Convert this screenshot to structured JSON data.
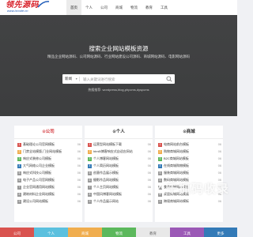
{
  "logo": {
    "name": "领先源码",
    "url": "www.lxcode.cn"
  },
  "nav": [
    {
      "label": "首页",
      "active": true
    },
    {
      "label": "个人",
      "active": false
    },
    {
      "label": "公司",
      "active": false
    },
    {
      "label": "商城",
      "active": false
    },
    {
      "label": "物流",
      "active": false
    },
    {
      "label": "教育",
      "active": false
    },
    {
      "label": "工具",
      "active": false
    }
  ],
  "hero": {
    "title": "搜索企业网站模板资源",
    "subtitle": "精品企业网站源码、公司网站源码、行业网站建设公司源码、商城网站源码、电影网站源码",
    "search_category": "新闻",
    "search_placeholder": "输入关键词进行搜索",
    "hot": "热搜推荐: wordpress,blog,phpcms,dyspcms"
  },
  "panels": [
    {
      "title": "⊙公司",
      "rows": [
        {
          "n": "1",
          "text": "基础理论公司官网模板",
          "date": "06"
        },
        {
          "n": "2",
          "text": "门禁全站模版,门业网站模板",
          "date": "06"
        },
        {
          "n": "3",
          "text": "响应式装修公司模板",
          "date": "06"
        },
        {
          "n": "4",
          "text": "大气网络公司企业模板",
          "date": "06"
        },
        {
          "n": "5",
          "text": "响应式科技公司模板",
          "date": "06"
        },
        {
          "n": "6",
          "text": "电子产品公司官网模板",
          "date": "06"
        },
        {
          "n": "7",
          "text": "企业官网通用网站模板",
          "date": "06"
        },
        {
          "n": "8",
          "text": "建筑材料企业网站模板",
          "date": "06"
        },
        {
          "n": "9",
          "text": "建设公司网站模板",
          "date": "06"
        }
      ]
    },
    {
      "title": "⊙个人",
      "rows": [
        {
          "n": "1",
          "text": "运营型网站模板下载",
          "date": "06"
        },
        {
          "n": "2",
          "text": "html5博客响应式自适应网站",
          "date": "06"
        },
        {
          "n": "3",
          "text": "个人博客网站模板",
          "date": "06"
        },
        {
          "n": "4",
          "text": "个人简历网站模板",
          "date": "06"
        },
        {
          "n": "5",
          "text": "创意作品展示模板",
          "date": "06"
        },
        {
          "n": "6",
          "text": "摄影作品网站模板",
          "date": "06"
        },
        {
          "n": "7",
          "text": "个人主页网站模板",
          "date": "06"
        },
        {
          "n": "8",
          "text": "中国风博客网站模板",
          "date": "06"
        },
        {
          "n": "9",
          "text": "个人作品展示网站",
          "date": "06"
        }
      ]
    },
    {
      "title": "⊙商城",
      "rows": [
        {
          "n": "1",
          "text": "电商网站前台模板",
          "date": "06"
        },
        {
          "n": "2",
          "text": "购物商城网站模板",
          "date": "06"
        },
        {
          "n": "3",
          "text": "B2C商城网站模板",
          "date": "06"
        },
        {
          "n": "4",
          "text": "在线商城购物模板",
          "date": "06"
        },
        {
          "n": "5",
          "text": "服装商城网站模板",
          "date": "06"
        },
        {
          "n": "6",
          "text": "数码商城网站模板",
          "date": "06"
        },
        {
          "n": "7",
          "text": "食品商城网站模板",
          "date": "06"
        },
        {
          "n": "8",
          "text": "家居商城网站模板",
          "date": "06"
        },
        {
          "n": "9",
          "text": "跨境商城网站模板",
          "date": "06"
        }
      ]
    }
  ],
  "categories": [
    {
      "label": "公司",
      "color": "#d9534f"
    },
    {
      "label": "个人",
      "color": "#5bc0de"
    },
    {
      "label": "商城",
      "color": "#f0ad4e"
    },
    {
      "label": "物流",
      "color": "#5cb85c"
    },
    {
      "label": "教育",
      "color": "#e8e8e8"
    },
    {
      "label": "工具",
      "color": "#9b59b6"
    },
    {
      "label": "更多",
      "color": "#337ab7"
    }
  ],
  "watermark": {
    "text": "千抓码收录",
    "url": "www.qianzhua.com"
  },
  "colors": {
    "accent": "#d43b40",
    "hero_bg": "#3f4041",
    "page_bg": "#f0f1f4"
  }
}
